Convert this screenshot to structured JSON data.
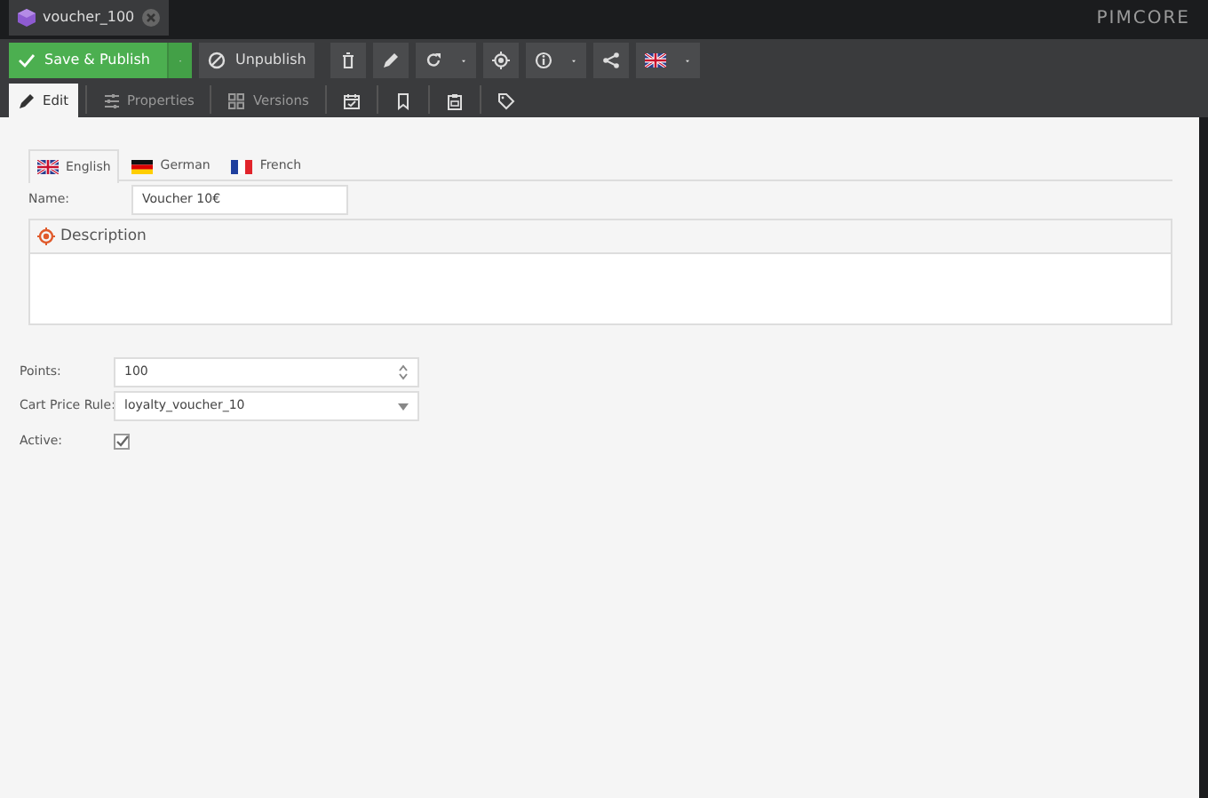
{
  "document_tab": {
    "title": "voucher_100"
  },
  "brand": "PIMCORE",
  "toolbar": [
    {
      "kind": "save",
      "label": "Save & Publish"
    },
    {
      "kind": "unpublish",
      "label": "Unpublish"
    },
    {
      "kind": "delete"
    },
    {
      "kind": "edit"
    },
    {
      "kind": "reload"
    },
    {
      "kind": "target"
    },
    {
      "kind": "info"
    },
    {
      "kind": "share"
    },
    {
      "kind": "language"
    }
  ],
  "tabs": [
    {
      "kind": "pencil",
      "label": "Edit",
      "selected": true
    },
    {
      "kind": "sliders",
      "label": "Properties",
      "selected": false
    },
    {
      "kind": "grid",
      "label": "Versions",
      "selected": false
    },
    {
      "kind": "calendar",
      "selected": false
    },
    {
      "kind": "bookmark",
      "selected": false
    },
    {
      "kind": "clipboard",
      "selected": false
    },
    {
      "kind": "tag",
      "selected": false
    }
  ],
  "language_tabs": [
    {
      "kind": "uk",
      "label": "English",
      "selected": true
    },
    {
      "kind": "de",
      "label": "German",
      "selected": false
    },
    {
      "kind": "fr",
      "label": "French",
      "selected": false
    }
  ],
  "name_field": {
    "label": "Name:",
    "value": "Voucher 10€"
  },
  "description_panel": {
    "title": "Description"
  },
  "points_field": {
    "label": "Points:",
    "value": "100"
  },
  "cart_price_rule_field": {
    "label": "Cart Price Rule:",
    "value": "loyalty_voucher_10"
  },
  "active_field": {
    "label": "Active:",
    "checked": true
  }
}
